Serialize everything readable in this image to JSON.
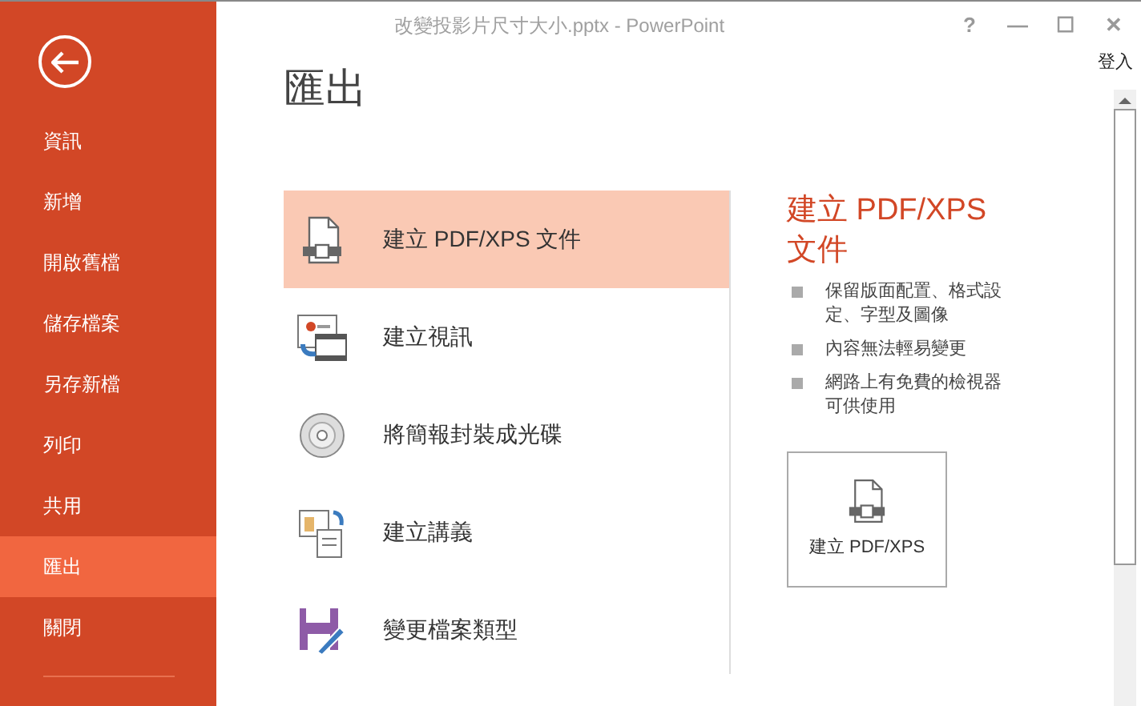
{
  "window": {
    "title": "改變投影片尺寸大小.pptx - PowerPoint",
    "controls": [
      "?",
      "—",
      "☐",
      "✕"
    ],
    "sign_in": "登入"
  },
  "sidebar": {
    "items": [
      {
        "label": "資訊",
        "selected": false
      },
      {
        "label": "新增",
        "selected": false
      },
      {
        "label": "開啟舊檔",
        "selected": false
      },
      {
        "label": "儲存檔案",
        "selected": false
      },
      {
        "label": "另存新檔",
        "selected": false
      },
      {
        "label": "列印",
        "selected": false
      },
      {
        "label": "共用",
        "selected": false
      },
      {
        "label": "匯出",
        "selected": true
      },
      {
        "label": "關閉",
        "selected": false
      }
    ]
  },
  "heading": "匯出",
  "options": [
    {
      "label": "建立 PDF/XPS 文件",
      "kind": "pdf",
      "selected": true
    },
    {
      "label": "建立視訊",
      "kind": "video",
      "selected": false
    },
    {
      "label": "將簡報封裝成光碟",
      "kind": "cd",
      "selected": false
    },
    {
      "label": "建立講義",
      "kind": "handout",
      "selected": false
    },
    {
      "label": "變更檔案類型",
      "kind": "filetype",
      "selected": false
    }
  ],
  "detail": {
    "title": "建立 PDF/XPS 文件",
    "bullets": [
      "保留版面配置、格式設定、字型及圖像",
      "內容無法輕易變更",
      "網路上有免費的檢視器可供使用"
    ],
    "button": "建立 PDF/XPS"
  }
}
